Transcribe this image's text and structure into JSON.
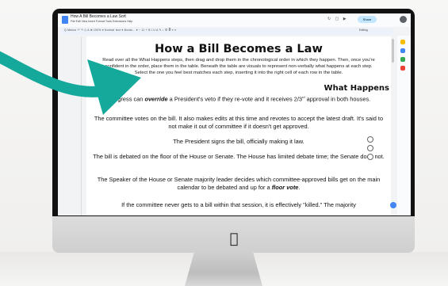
{
  "app": {
    "doc_title": "How A Bill Becomes a Law Sort",
    "menus": "File  Edit  View  Insert  Format  Tools  Extensions  Help",
    "toolbar_text": "Q  Menus   ↶  ↷  ⎙  A  ⊕   100%  ▾   Normal text ▾   Monts... ▾   −  11  +   B  I  U  A  ✎   ↕  ☰  ≣  ≡  ≡",
    "share_label": "Share",
    "editing_label": "Editing"
  },
  "document": {
    "title": "How a Bill Becomes a Law",
    "intro": "Read over all the What Happens steps, then drag and drop them in the chronological order in which they happen. Then, once you're confident in the order, place them in the table. Beneath the table are visuals to represent non-verbally what happens at each step. Select the one you feel best matches each step, inserting it into the right cell of each row in the table.",
    "section_heading": "What Happens",
    "items": [
      "Congress can override a President's veto if they re-vote and it receives 2/3rd approval in both houses.",
      "The committee votes on the bill. It also makes edits at this time and revotes to accept the latest draft. It's said to not make it out of committee if it doesn't get approved.",
      "The President signs the bill, officially making it law.",
      "The bill is debated on the floor of the House or Senate. The House has limited debate time; the Senate does not.",
      "The Speaker of the House or Senate majority leader decides which committee-approved bills get on the main calendar to be debated and up for a floor vote.",
      "If the committee never gets to a bill within that session, it is effectively \"killed.\" The majority"
    ]
  },
  "colors": {
    "arrow": "#15a99b",
    "share_bg": "#c2e7ff",
    "bezel": "#121212"
  },
  "icons": [
    "docs-icon",
    "star-icon",
    "history-icon",
    "comment-icon",
    "video-icon",
    "avatar",
    "apple-logo",
    "arrow-graphic"
  ]
}
